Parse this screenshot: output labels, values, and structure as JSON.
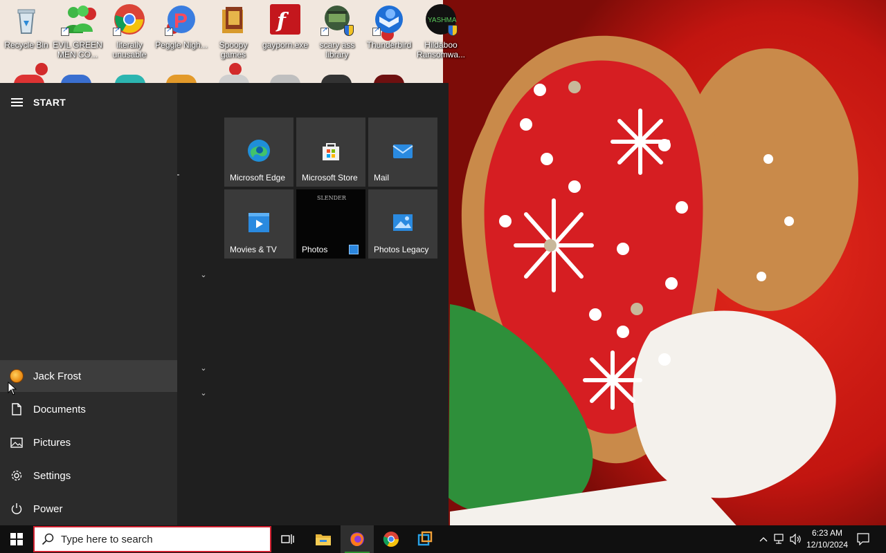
{
  "desktop": {
    "icons": [
      {
        "label": "Recycle Bin",
        "icon": "recycle-bin-icon"
      },
      {
        "label": "EVIL GREEN MEN CO...",
        "icon": "people-icon"
      },
      {
        "label": "literally unusable",
        "icon": "chrome-icon"
      },
      {
        "label": "Peggle Nigh...",
        "icon": "peggle-icon"
      },
      {
        "label": "Spoopy games",
        "icon": "folder-icon"
      },
      {
        "label": "gayporn.exe",
        "icon": "flash-icon"
      },
      {
        "label": "scary ass library",
        "icon": "library-icon"
      },
      {
        "label": "Thunderbird",
        "icon": "thunderbird-icon"
      },
      {
        "label": "Hildaboo Ransomwa...",
        "icon": "yashma-icon"
      }
    ]
  },
  "start": {
    "title": "START",
    "user": "Jack Frost",
    "items": [
      {
        "label": "Documents",
        "icon": "document-icon"
      },
      {
        "label": "Pictures",
        "icon": "pictures-icon"
      },
      {
        "label": "Settings",
        "icon": "gear-icon"
      },
      {
        "label": "Power",
        "icon": "power-icon"
      }
    ],
    "tiles": [
      {
        "label": "Microsoft Edge",
        "icon": "edge-icon"
      },
      {
        "label": "Microsoft Store",
        "icon": "store-icon"
      },
      {
        "label": "Mail",
        "icon": "mail-icon"
      },
      {
        "label": "Movies & TV",
        "icon": "movies-icon"
      },
      {
        "label": "Photos",
        "icon": "photos-icon",
        "thumb_text": "SLENDER"
      },
      {
        "label": "Photos Legacy",
        "icon": "photos-legacy-icon"
      }
    ]
  },
  "taskbar": {
    "search_placeholder": "Type here to search",
    "time": "6:23 AM",
    "date": "12/10/2024",
    "apps": [
      "task-view-icon",
      "file-explorer-icon",
      "firefox-icon",
      "chrome-icon",
      "virtualbox-icon"
    ]
  },
  "colors": {
    "accent_red": "#d01f2f",
    "start_bg": "#1f1f1f",
    "rail_bg": "#2b2b2b",
    "tile_bg": "#3a3a3a"
  }
}
